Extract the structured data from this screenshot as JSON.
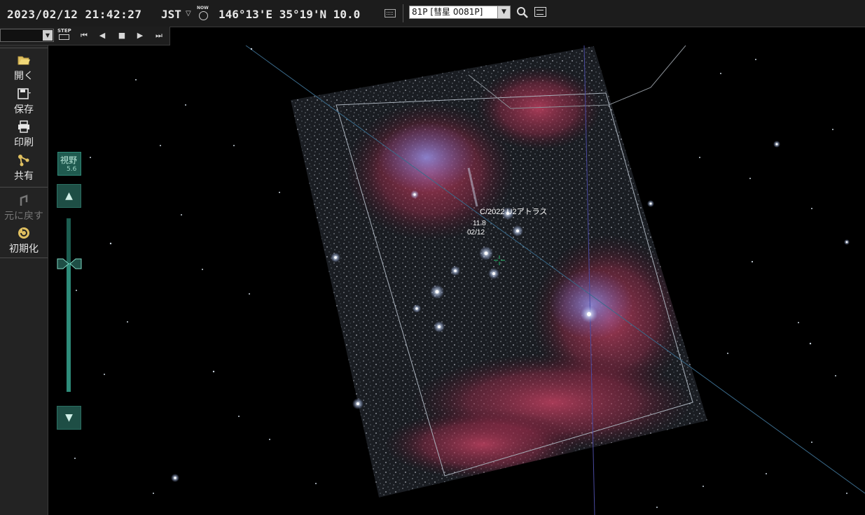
{
  "topbar": {
    "datetime": "2023/02/12 21:42:27",
    "timezone": "JST",
    "now_label": "NOW",
    "coords": "146°13'E 35°19'N 10.0",
    "target": "81P [彗星 0081P]"
  },
  "row2": {
    "step_label": "STEP"
  },
  "leftpanel": {
    "open": "開く",
    "save": "保存",
    "print": "印刷",
    "share": "共有",
    "undo": "元に戻す",
    "reset": "初期化"
  },
  "zoom": {
    "fov_label": "視野",
    "fov_value": "5.6"
  },
  "sky": {
    "comet_name": "C/2022 U2アトラス",
    "comet_mag": "11.8",
    "comet_date": "02/12"
  },
  "colors": {
    "accent": "#2e8c7a",
    "toolbar_bg": "#1c1c1c",
    "panel_bg": "#232323"
  }
}
